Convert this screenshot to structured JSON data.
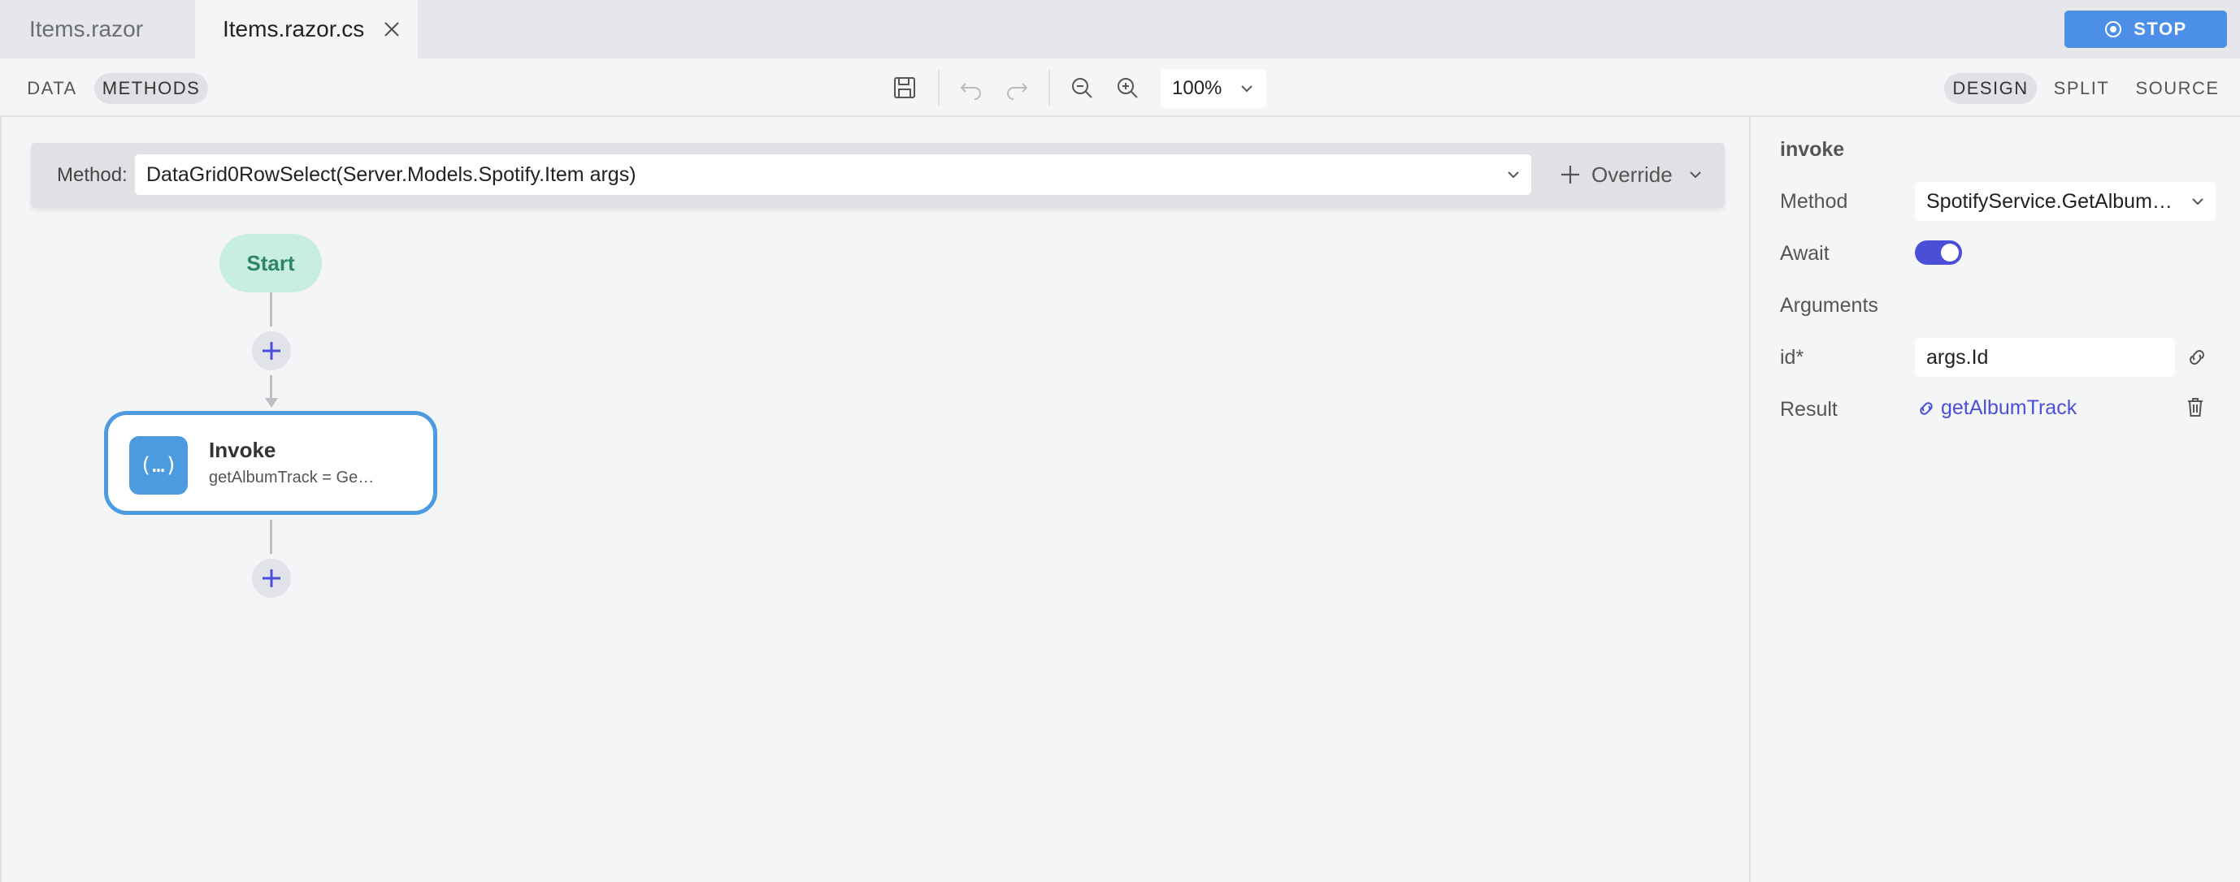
{
  "tabs": [
    {
      "label": "Items.razor",
      "active": false
    },
    {
      "label": "Items.razor.cs",
      "active": true
    }
  ],
  "stop_button": {
    "label": "STOP"
  },
  "toolbar": {
    "modes_left": [
      "DATA",
      "METHODS"
    ],
    "active_left": "METHODS",
    "zoom": "100%",
    "views": [
      "DESIGN",
      "SPLIT",
      "SOURCE"
    ],
    "active_view": "DESIGN"
  },
  "method_bar": {
    "label": "Method:",
    "selected": "DataGrid0RowSelect(Server.Models.Spotify.Item args)",
    "override_label": "Override"
  },
  "flow": {
    "start_label": "Start",
    "invoke": {
      "title": "Invoke",
      "subtitle": "getAlbumTrack = Ge…"
    }
  },
  "panel": {
    "title": "invoke",
    "method_label": "Method",
    "method_value": "SpotifyService.GetAlbum…",
    "await_label": "Await",
    "await_on": true,
    "arguments_label": "Arguments",
    "arg_name": "id*",
    "arg_value": "args.Id",
    "result_label": "Result",
    "result_value": "getAlbumTrack"
  },
  "colors": {
    "accent": "#4c8fe8",
    "node_border": "#4c9ae0",
    "start_bg": "#c8ede3",
    "toggle": "#4b4fd8"
  }
}
